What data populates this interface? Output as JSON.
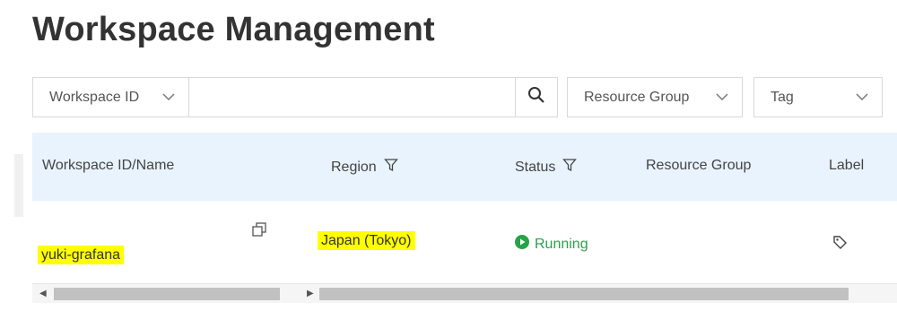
{
  "page": {
    "title": "Workspace Management"
  },
  "filters": {
    "id_select_label": "Workspace ID",
    "search_value": "",
    "resource_group_label": "Resource Group",
    "tag_label": "Tag"
  },
  "table": {
    "columns": [
      "Workspace ID/Name",
      "Region",
      "Status",
      "Resource Group",
      "Label"
    ],
    "rows": [
      {
        "name": "yuki-grafana",
        "region": "Japan (Tokyo)",
        "status": "Running",
        "resource_group": ""
      }
    ]
  },
  "colors": {
    "header_bg": "#e8f3fd",
    "status_running": "#27a348",
    "highlight": "#ffff00"
  },
  "icons": [
    "chevron-down-icon",
    "search-icon",
    "filter-icon",
    "copy-icon",
    "play-circle-icon",
    "tag-icon",
    "scroll-left-icon",
    "scroll-right-icon"
  ]
}
